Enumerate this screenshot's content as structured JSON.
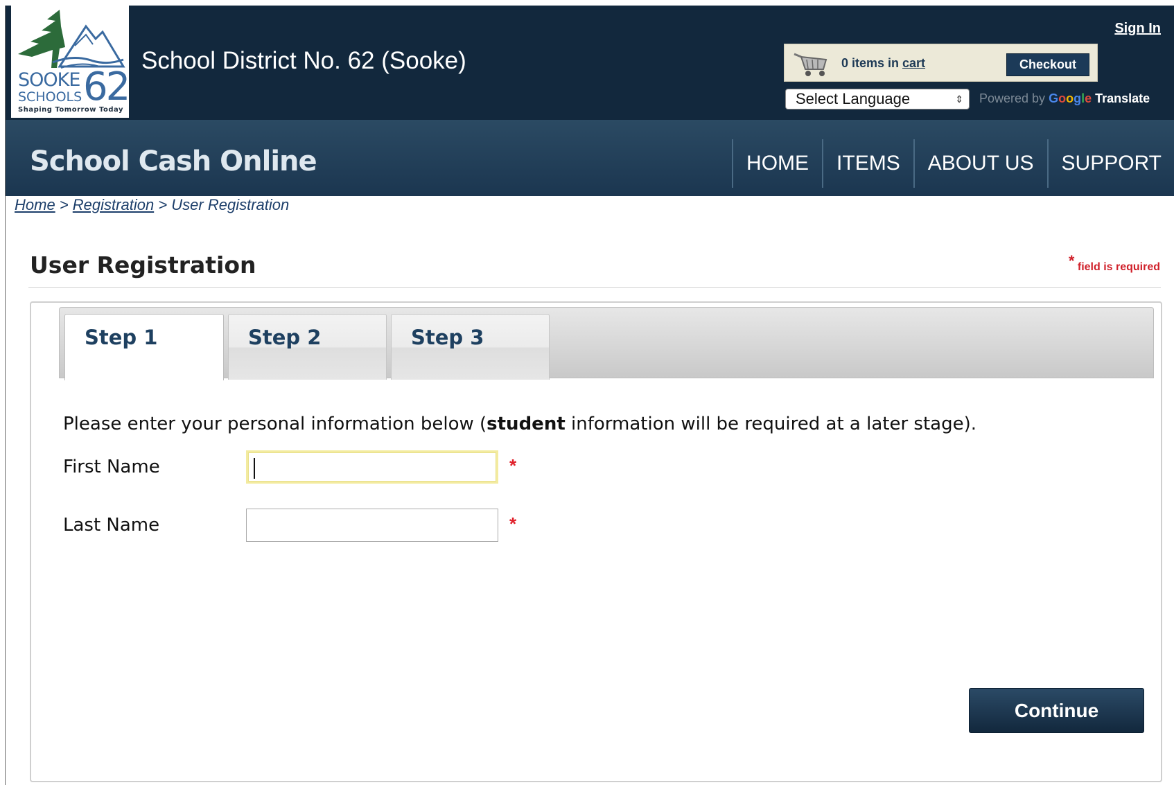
{
  "header": {
    "logo": {
      "line1": "SOOKE",
      "line2": "SCHOOLS",
      "number": "62",
      "tagline": "Shaping Tomorrow Today"
    },
    "district_title": "School District No. 62 (Sooke)",
    "sign_in": "Sign In",
    "cart": {
      "count_text": "0 items in ",
      "link_text": "cart",
      "checkout_label": "Checkout"
    },
    "language": {
      "selected": "Select Language",
      "powered_by": "Powered by ",
      "google_letters": [
        "G",
        "o",
        "o",
        "g",
        "l",
        "e"
      ],
      "translate": "Translate"
    }
  },
  "nav": {
    "brand": "School Cash Online",
    "items": [
      "HOME",
      "ITEMS",
      "ABOUT US",
      "SUPPORT"
    ]
  },
  "breadcrumb": {
    "items": [
      "Home",
      "Registration",
      "User Registration"
    ],
    "separator": ">"
  },
  "page": {
    "title": "User Registration",
    "required_star": "*",
    "required_note": "field is required"
  },
  "steps": {
    "tabs": [
      "Step 1",
      "Step 2",
      "Step 3"
    ],
    "active": "Step 1"
  },
  "form": {
    "intro_before": "Please enter your personal information below (",
    "intro_bold": "student",
    "intro_after": " information will be required at a later stage).",
    "first_name": {
      "label": "First Name",
      "value": "",
      "required": "*"
    },
    "last_name": {
      "label": "Last Name",
      "value": "",
      "required": "*"
    },
    "continue_label": "Continue"
  },
  "colors": {
    "header_bg": "#12283d",
    "nav_bg": "#1b3650",
    "required_red": "#e0202a",
    "link_blue": "#1c3e6a"
  }
}
